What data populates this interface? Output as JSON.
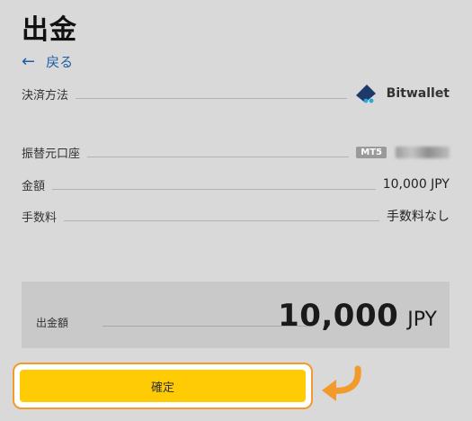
{
  "header": {
    "title": "出金"
  },
  "nav": {
    "back_label": "戻る"
  },
  "details": {
    "method_label": "決済方法",
    "method_value": "Bitwallet",
    "account_label": "振替元口座",
    "account_badge": "MT5",
    "amount_label": "金額",
    "amount_value": "10,000 JPY",
    "fee_label": "手数料",
    "fee_value": "手数料なし"
  },
  "total": {
    "label": "出金額",
    "amount": "10,000",
    "currency": "JPY"
  },
  "actions": {
    "confirm_label": "確定"
  },
  "colors": {
    "accent_link": "#1f5fa8",
    "button": "#ffcb05",
    "highlight": "#f39a2c"
  }
}
